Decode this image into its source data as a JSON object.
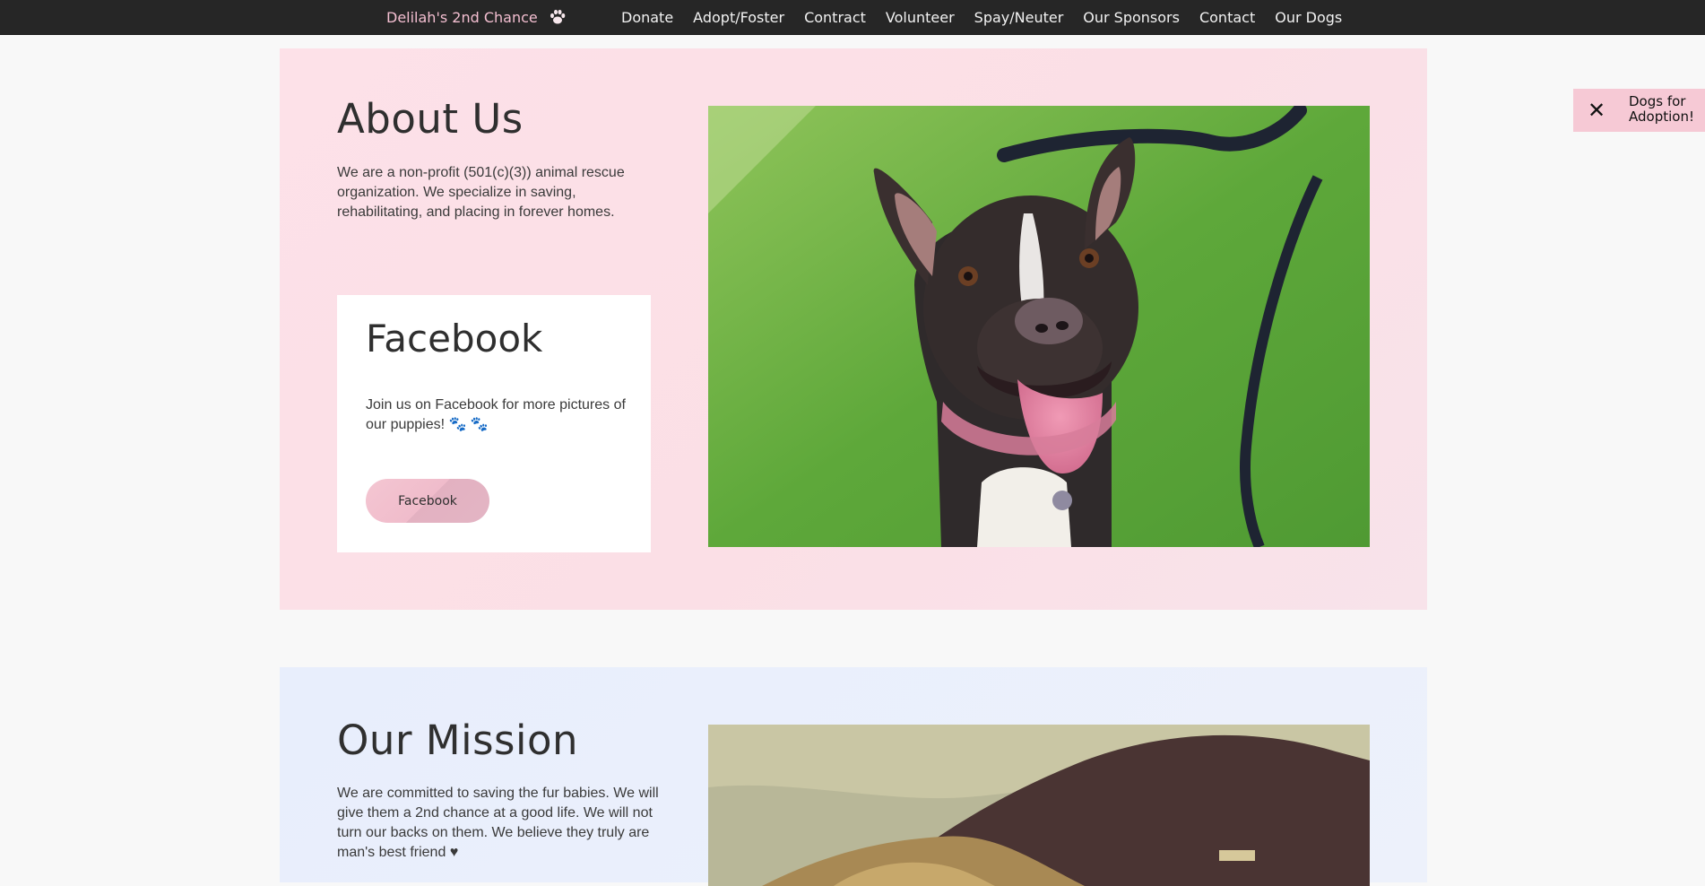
{
  "nav": {
    "brand": "Delilah's 2nd Chance",
    "brand_icon": "paw-icon",
    "links": [
      "Donate",
      "Adopt/Foster",
      "Contract",
      "Volunteer",
      "Spay/Neuter",
      "Our Sponsors",
      "Contact",
      "Our Dogs"
    ]
  },
  "about": {
    "title": "About Us",
    "text": "We are a non-profit (501(c)(3)) animal rescue organization. We specialize in saving, rehabilitating, and placing in forever homes.",
    "photo": "dog-photo"
  },
  "facebook": {
    "title": "Facebook",
    "text": "Join us on Facebook for more pictures of our puppies! 🐾 🐾",
    "button_label": "Facebook"
  },
  "mission": {
    "title": "Our Mission",
    "text": "We are committed to saving the fur babies. We will give them a 2nd chance at a good life. We will not turn our backs on them. We believe they truly are man's best friend ♥",
    "photo": "landscape-photo"
  },
  "side_tab": {
    "label": "Dogs for Adoption!",
    "close_icon": "close-icon"
  },
  "colors": {
    "nav_bg": "#262626",
    "brand": "#f4bfd1",
    "about_bg": "#fde1e8",
    "mission_bg": "#e8eefc",
    "button": "#f0bccb"
  }
}
